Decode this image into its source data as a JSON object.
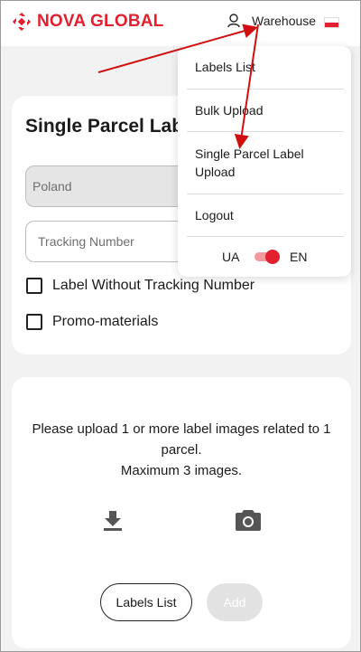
{
  "header": {
    "brand": "NOVA GLOBAL",
    "user_icon": "user-icon",
    "warehouse_label": "Warehouse",
    "flag": "poland-flag",
    "brand_color": "#e3202f"
  },
  "form_card": {
    "title": "Single Parcel Lab",
    "country_value": "Poland",
    "tracking_placeholder": "Tracking Number",
    "checkbox_no_tracking": "Label Without Tracking Number",
    "checkbox_promo": "Promo-materials"
  },
  "upload_card": {
    "line1": "Please upload 1 or more label images related to 1 parcel.",
    "line2": "Maximum 3 images.",
    "download_icon": "download-icon",
    "camera_icon": "camera-icon",
    "labels_list_button": "Labels List",
    "add_button": "Add"
  },
  "menu": {
    "items": [
      "Labels List",
      "Bulk Upload",
      "Single Parcel Label Upload",
      "Logout"
    ],
    "lang_left": "UA",
    "lang_right": "EN"
  },
  "colors": {
    "accent": "#e3202f",
    "annotation_arrow": "#d01010"
  }
}
